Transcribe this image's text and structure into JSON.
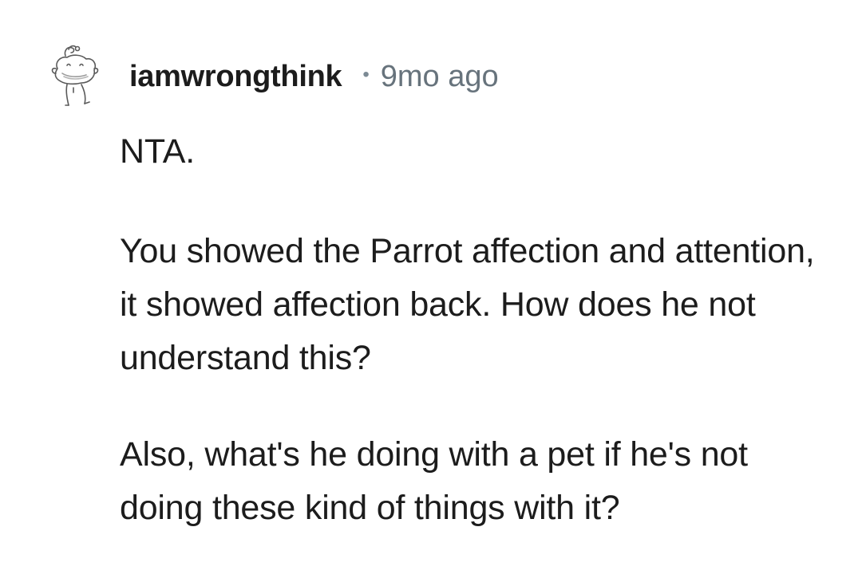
{
  "comment": {
    "avatar_icon": "snoo-sketch-avatar-icon",
    "username": "iamwrongthink",
    "separator": "•",
    "timestamp": "9mo ago",
    "paragraphs": [
      "NTA.",
      "You showed the Parrot affection and attention, it showed affection back. How does he not understand this?",
      "Also, what's he doing with a pet if he's not doing these kind of things with it?"
    ]
  },
  "colors": {
    "text": "#1c1c1c",
    "meta": "#67737c",
    "background": "#ffffff"
  }
}
